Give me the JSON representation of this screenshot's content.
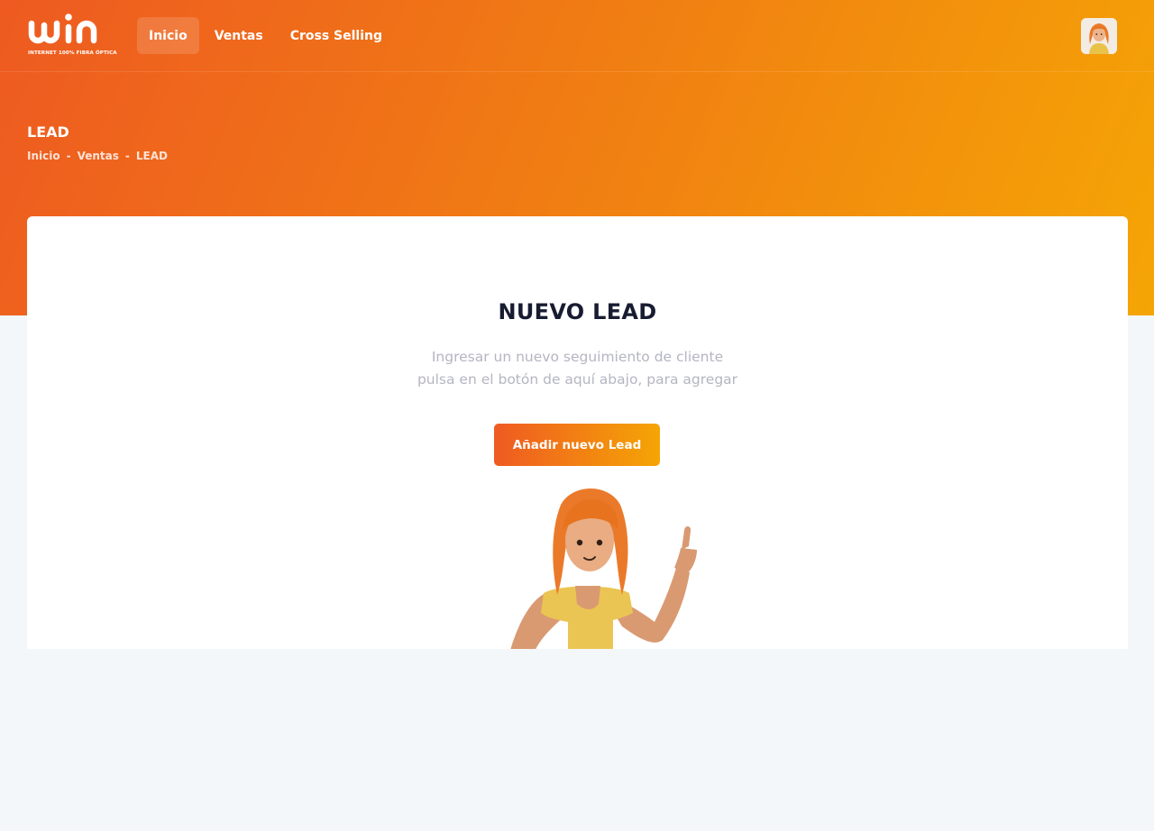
{
  "brand": {
    "logo_text": "win",
    "tagline": "INTERNET 100% FIBRA ÓPTICA",
    "primary_color": "#ee5a21",
    "secondary_color": "#f5a505"
  },
  "nav": {
    "items": [
      {
        "label": "Inicio",
        "active": true
      },
      {
        "label": "Ventas",
        "active": false
      },
      {
        "label": "Cross Selling",
        "active": false
      }
    ]
  },
  "user": {
    "avatar_icon": "user-avatar"
  },
  "page": {
    "title": "LEAD",
    "breadcrumb": [
      "Inicio",
      "Ventas",
      "LEAD"
    ],
    "breadcrumb_separator": "-"
  },
  "card": {
    "title": "NUEVO LEAD",
    "description_line1": "Ingresar un nuevo seguimiento de cliente",
    "description_line2": "pulsa en el botón de aquí abajo, para agregar",
    "button_label": "Añadir nuevo Lead",
    "illustration": "character-pointing-up"
  }
}
